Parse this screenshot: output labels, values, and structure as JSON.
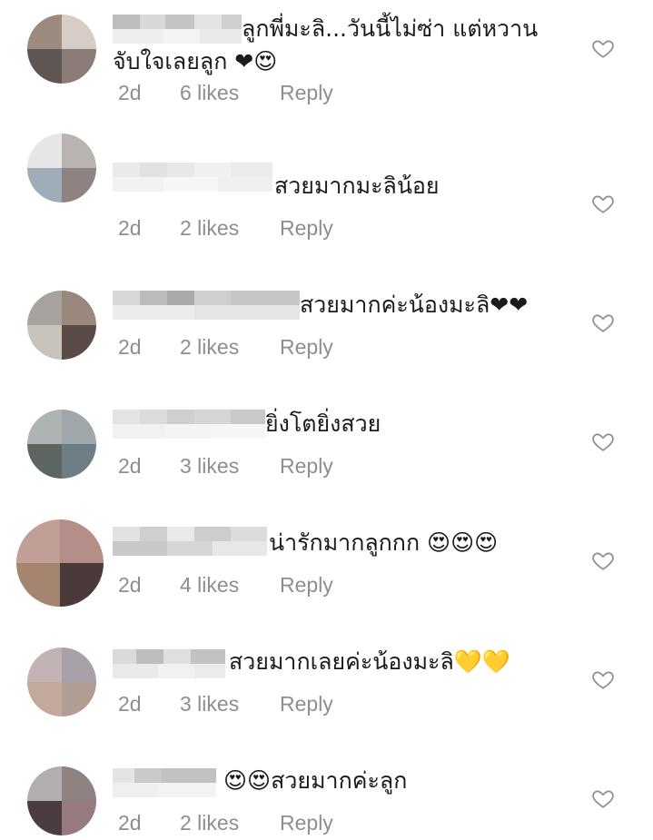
{
  "comments": [
    {
      "text": "ลูกพี่มะลิ...วันนี้ไม่ซ่า แต่หวานจับใจเลยลูก ❤😍",
      "time": "2d",
      "likes": "6 likes",
      "reply": "Reply"
    },
    {
      "text": "สวยมากมะลิน้อย",
      "time": "2d",
      "likes": "2 likes",
      "reply": "Reply"
    },
    {
      "text": "สวยมากค่ะน้องมะลิ❤❤",
      "time": "2d",
      "likes": "2 likes",
      "reply": "Reply"
    },
    {
      "text": "ยิ่งโตยิ่งสวย",
      "time": "2d",
      "likes": "3 likes",
      "reply": "Reply"
    },
    {
      "text": "น่ารักมากลูกกก 😍😍😍",
      "time": "2d",
      "likes": "4 likes",
      "reply": "Reply"
    },
    {
      "text": "สวยมากเลยค่ะน้องมะลิ💛💛",
      "time": "2d",
      "likes": "3 likes",
      "reply": "Reply"
    },
    {
      "text": "😍😍สวยมากค่ะลูก",
      "time": "2d",
      "likes": "2 likes",
      "reply": "Reply"
    }
  ],
  "icons": {
    "like": "heart-outline-icon"
  },
  "colors": {
    "meta_text": "#8e8e8e",
    "comment_text": "#1b1b1b",
    "heart_stroke": "#8e8e8e"
  }
}
